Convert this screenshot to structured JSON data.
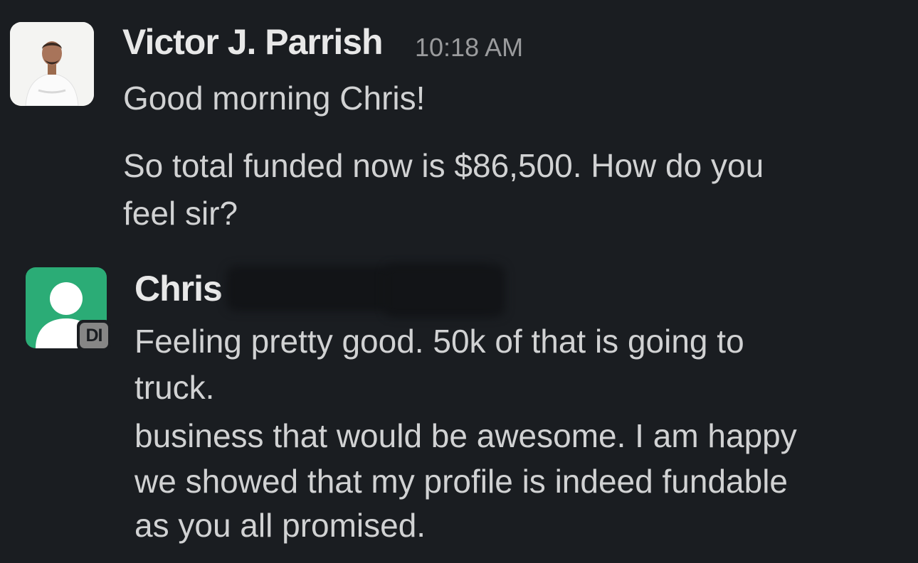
{
  "messages": [
    {
      "author": "Victor J. Parrish",
      "timestamp": "10:18 AM",
      "avatar_icon": "user-photo-avatar",
      "lines": [
        "Good morning Chris!",
        "So total funded now is $86,500. How do you",
        "feel sir?"
      ]
    },
    {
      "author": "Chris",
      "avatar_icon": "default-user-avatar",
      "avatar_color": "#2bac76",
      "badge": "DI",
      "lines": [
        "Feeling pretty good. 50k of that is going to",
        "truck.",
        "business that would be awesome. I am happy",
        "we showed that my profile is indeed fundable",
        "as you all promised."
      ]
    }
  ]
}
